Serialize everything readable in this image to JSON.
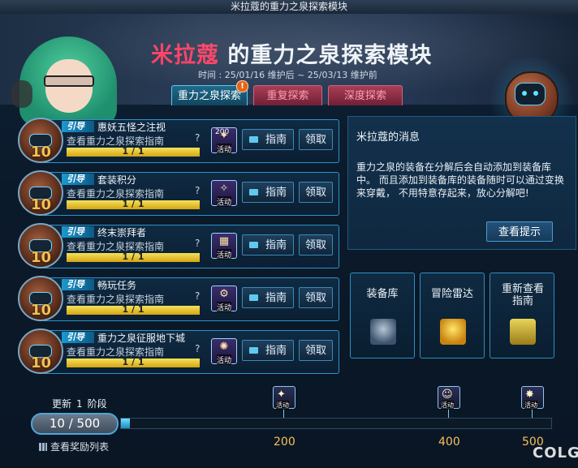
{
  "window": {
    "title": "米拉蔻的重力之泉探索模块"
  },
  "header": {
    "title_highlight": "米拉蔻",
    "title_rest": " 的重力之泉探索模块",
    "subtitle": "时间 : 25/01/16 维护后 ~ 25/03/13 维护前"
  },
  "tabs": [
    {
      "label": "重力之泉探索",
      "active": true,
      "alert": "!"
    },
    {
      "label": "重复探索",
      "active": false
    },
    {
      "label": "深度探索",
      "active": false
    }
  ],
  "quests": [
    {
      "tag": "引导",
      "level": "10",
      "title": "惠妖五怪之注视",
      "desc": "查看重力之泉探索指南",
      "question": "?",
      "progress_text": "1 / 1",
      "progress": 1.0,
      "reward_count": "200",
      "reward_label": "活动",
      "guide_label": "指南",
      "claim_label": "领取"
    },
    {
      "tag": "引导",
      "level": "10",
      "title": "套装积分",
      "desc": "查看重力之泉探索指南",
      "question": "?",
      "progress_text": "1 / 1",
      "progress": 1.0,
      "reward_count": "",
      "reward_label": "活动",
      "guide_label": "指南",
      "claim_label": "领取"
    },
    {
      "tag": "引导",
      "level": "10",
      "title": "终末崇拜者",
      "desc": "查看重力之泉探索指南",
      "question": "?",
      "progress_text": "1 / 1",
      "progress": 1.0,
      "reward_count": "",
      "reward_label": "活动",
      "guide_label": "指南",
      "claim_label": "领取"
    },
    {
      "tag": "引导",
      "level": "10",
      "title": "畅玩任务",
      "desc": "查看重力之泉探索指南",
      "question": "?",
      "progress_text": "1 / 1",
      "progress": 1.0,
      "reward_count": "",
      "reward_label": "活动",
      "guide_label": "指南",
      "claim_label": "领取"
    },
    {
      "tag": "引导",
      "level": "10",
      "title": "重力之泉征服地下城",
      "desc": "查看重力之泉探索指南",
      "question": "?",
      "progress_text": "1 / 1",
      "progress": 1.0,
      "reward_count": "",
      "reward_label": "活动",
      "guide_label": "指南",
      "claim_label": "领取"
    }
  ],
  "message": {
    "title": "米拉蔻的消息",
    "body": "重力之泉的装备在分解后会自动添加到装备库中。 而且添加到装备库的装备随时可以通过变换来穿戴， 不用特意存起来，放心分解吧!",
    "button": "查看提示"
  },
  "features": [
    {
      "label": "装备库",
      "icon": "armor-icon"
    },
    {
      "label": "冒险雷达",
      "icon": "radar-icon"
    },
    {
      "label": "重新查看指南",
      "icon": "signpost-icon"
    }
  ],
  "progress": {
    "update_label": "更新",
    "stage_value": "1",
    "stage_label": "阶段",
    "counter": "10 / 500",
    "current": 10,
    "max": 500,
    "milestones": [
      {
        "value": 200,
        "label": "200",
        "badge": "活动"
      },
      {
        "value": 400,
        "label": "400",
        "badge": "活动"
      },
      {
        "value": 500,
        "label": "500",
        "badge": "活动"
      }
    ],
    "reward_list_label": "查看奖励列表"
  },
  "watermark": {
    "text": "COLG"
  },
  "colors": {
    "accent": "#ff3b5f",
    "level": "#f3c04f",
    "progress": "#f5e25a",
    "frame": "#2b93c8"
  }
}
